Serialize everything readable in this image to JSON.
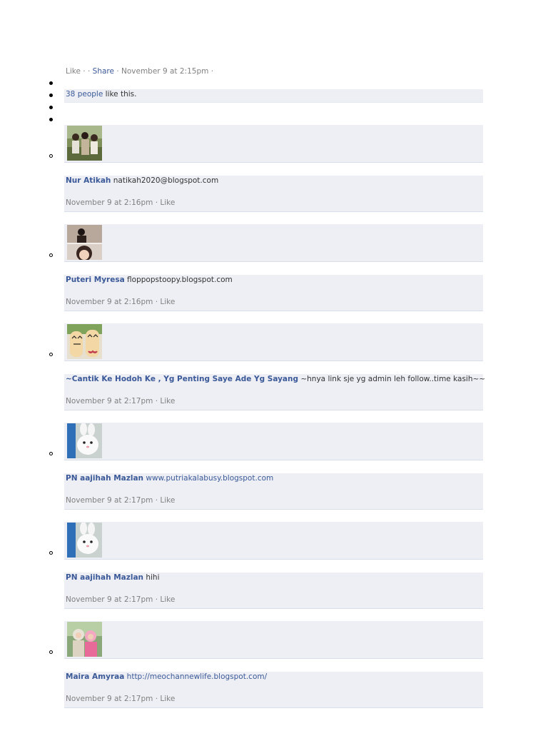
{
  "action_bar": {
    "like": "Like",
    "sep1": "·",
    "sep2": "·",
    "share": "Share",
    "sep3": "·",
    "timestamp": "November 9 at 2:15pm",
    "sep4": "·"
  },
  "likes": {
    "count_link": "38 people",
    "suffix": "like this."
  },
  "comments": [
    {
      "author": "Nur Atikah",
      "text": "natikah2020@blogspot.com",
      "time": "November 9 at 2:16pm",
      "sep": "·",
      "like": "Like",
      "avatar": "avatar-photo-group"
    },
    {
      "author": "Puteri Myresa",
      "text": "floppopstoopy.blogspot.com",
      "time": "November 9 at 2:16pm",
      "sep": "·",
      "like": "Like",
      "avatar": "avatar-photo-girl"
    },
    {
      "author": "~Cantik Ke Hodoh Ke , Yg Penting Saye Ade Yg Sayang",
      "text": "~hnya link sje yg admin leh follow..time kasih~~",
      "time": "November 9 at 2:17pm",
      "sep": "·",
      "like": "Like",
      "avatar": "avatar-finger-faces"
    },
    {
      "author": "PN aajihah Mazlan",
      "text": "www.putriakalabusy.blogspot.com",
      "text_is_link": true,
      "time": "November 9 at 2:17pm",
      "sep": "·",
      "like": "Like",
      "avatar": "avatar-rabbit"
    },
    {
      "author": "PN aajihah Mazlan",
      "text": "hihi",
      "time": "November 9 at 2:17pm",
      "sep": "·",
      "like": "Like",
      "avatar": "avatar-rabbit"
    },
    {
      "author": "Maira Amyraa",
      "text": "http://meochannewlife.blogspot.com/",
      "text_is_link": true,
      "time": "November 9 at 2:17pm",
      "sep": "·",
      "like": "Like",
      "avatar": "avatar-photo-couple"
    }
  ]
}
